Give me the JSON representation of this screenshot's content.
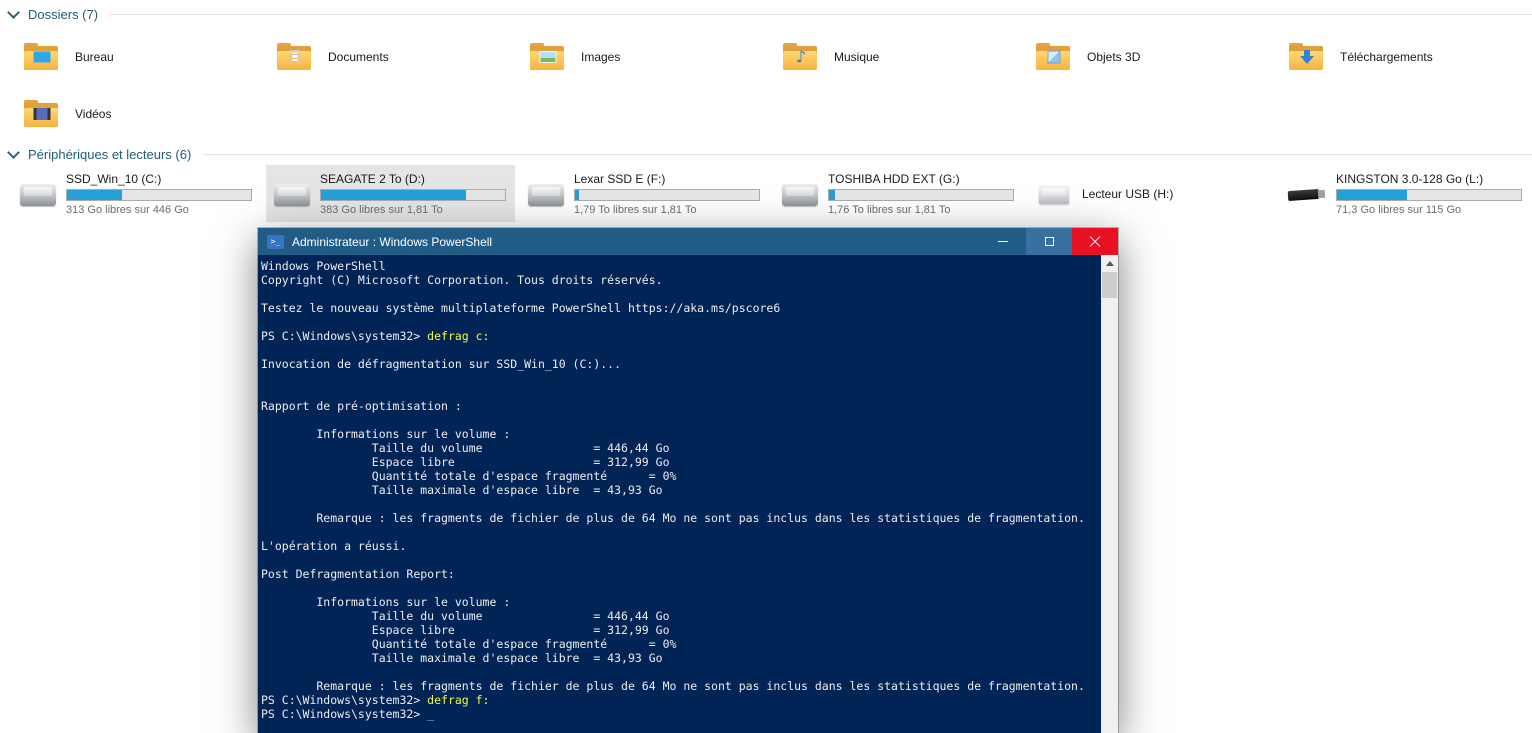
{
  "colors": {
    "progress_fill": "#26a0da",
    "selection_bg": "#e5e5e5",
    "console_bg": "#012456",
    "console_text": "#eeedf0",
    "command_color": "#f7f73d",
    "titlebar_bg": "#215c87",
    "close_button_bg": "#e81123",
    "group_header_color": "#1e5c78"
  },
  "explorer": {
    "folders_group": {
      "label": "Dossiers (7)"
    },
    "drives_group": {
      "label": "Périphériques et lecteurs (6)"
    },
    "folders": [
      {
        "id": "bureau",
        "name": "Bureau",
        "icon": "desktop-folder-icon"
      },
      {
        "id": "documents",
        "name": "Documents",
        "icon": "documents-folder-icon"
      },
      {
        "id": "images",
        "name": "Images",
        "icon": "pictures-folder-icon"
      },
      {
        "id": "musique",
        "name": "Musique",
        "icon": "music-folder-icon"
      },
      {
        "id": "objets-3d",
        "name": "Objets 3D",
        "icon": "3d-objects-folder-icon"
      },
      {
        "id": "telechargements",
        "name": "Téléchargements",
        "icon": "downloads-folder-icon"
      },
      {
        "id": "videos",
        "name": "Vidéos",
        "icon": "videos-folder-icon"
      }
    ],
    "drives": [
      {
        "id": "c",
        "name": "SSD_Win_10 (C:)",
        "free_text": "313 Go libres sur 446 Go",
        "used_percent": 30,
        "selected": false,
        "icon": "hard-drive"
      },
      {
        "id": "d",
        "name": "SEAGATE 2 To (D:)",
        "free_text": "383 Go libres sur 1,81 To",
        "used_percent": 79,
        "selected": true,
        "icon": "hard-drive"
      },
      {
        "id": "f",
        "name": "Lexar SSD E (F:)",
        "free_text": "1,79 To libres sur 1,81 To",
        "used_percent": 2,
        "selected": false,
        "icon": "hard-drive"
      },
      {
        "id": "g",
        "name": "TOSHIBA HDD EXT (G:)",
        "free_text": "1,76 To libres sur 1,81 To",
        "used_percent": 3,
        "selected": false,
        "icon": "hard-drive"
      },
      {
        "id": "h",
        "name": "Lecteur USB (H:)",
        "free_text": "",
        "used_percent": null,
        "selected": false,
        "icon": "usb-drive"
      },
      {
        "id": "l",
        "name": "KINGSTON 3.0-128 Go (L:)",
        "free_text": "71,3 Go libres sur 115 Go",
        "used_percent": 38,
        "selected": false,
        "icon": "usb-stick"
      }
    ]
  },
  "powershell": {
    "title": "Administrateur : Windows PowerShell",
    "window_controls": [
      {
        "id": "minimize",
        "icon": "minimize-icon"
      },
      {
        "id": "maximize",
        "icon": "maximize-icon"
      },
      {
        "id": "close",
        "icon": "close-icon"
      }
    ],
    "lines": [
      [
        {
          "t": "Windows PowerShell"
        }
      ],
      [
        {
          "t": "Copyright (C) Microsoft Corporation. Tous droits réservés."
        }
      ],
      [],
      [
        {
          "t": "Testez le nouveau système multiplateforme PowerShell https://aka.ms/pscore6"
        }
      ],
      [],
      [
        {
          "t": "PS C:\\Windows\\system32> "
        },
        {
          "t": "defrag c:",
          "c": "cmd"
        }
      ],
      [],
      [
        {
          "t": "Invocation de défragmentation sur SSD_Win_10 (C:)..."
        }
      ],
      [],
      [],
      [
        {
          "t": "Rapport de pré-optimisation :"
        }
      ],
      [],
      [
        {
          "t": "        Informations sur le volume :"
        }
      ],
      [
        {
          "t": "                Taille du volume                = 446,44 Go"
        }
      ],
      [
        {
          "t": "                Espace libre                    = 312,99 Go"
        }
      ],
      [
        {
          "t": "                Quantité totale d'espace fragmenté      = 0%"
        }
      ],
      [
        {
          "t": "                Taille maximale d'espace libre  = 43,93 Go"
        }
      ],
      [],
      [
        {
          "t": "        Remarque : les fragments de fichier de plus de 64 Mo ne sont pas inclus dans les statistiques de fragmentation."
        }
      ],
      [],
      [
        {
          "t": "L'opération a réussi."
        }
      ],
      [],
      [
        {
          "t": "Post Defragmentation Report:"
        }
      ],
      [],
      [
        {
          "t": "        Informations sur le volume :"
        }
      ],
      [
        {
          "t": "                Taille du volume                = 446,44 Go"
        }
      ],
      [
        {
          "t": "                Espace libre                    = 312,99 Go"
        }
      ],
      [
        {
          "t": "                Quantité totale d'espace fragmenté      = 0%"
        }
      ],
      [
        {
          "t": "                Taille maximale d'espace libre  = 43,93 Go"
        }
      ],
      [],
      [
        {
          "t": "        Remarque : les fragments de fichier de plus de 64 Mo ne sont pas inclus dans les statistiques de fragmentation."
        }
      ],
      [
        {
          "t": "PS C:\\Windows\\system32> "
        },
        {
          "t": "defrag f:",
          "c": "cmd"
        }
      ],
      [
        {
          "t": "PS C:\\Windows\\system32> "
        },
        {
          "t": "_",
          "c": "cursor"
        }
      ]
    ]
  }
}
